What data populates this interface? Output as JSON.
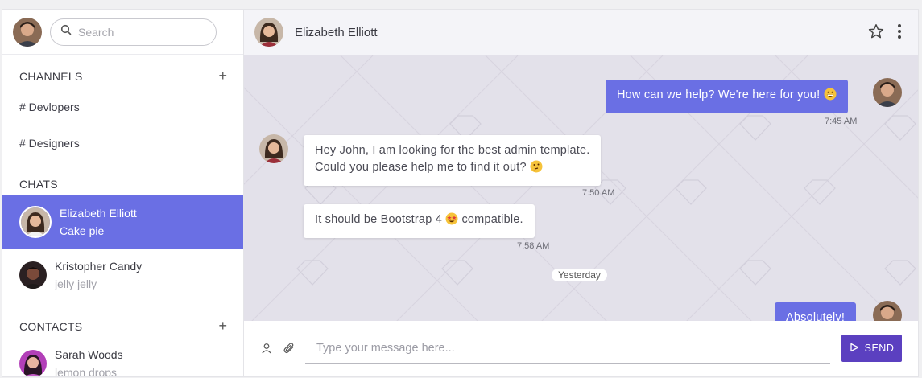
{
  "search": {
    "placeholder": "Search"
  },
  "sidebar": {
    "channels_heading": "CHANNELS",
    "channels": [
      {
        "label": "# Devlopers"
      },
      {
        "label": "# Designers"
      }
    ],
    "chats_heading": "CHATS",
    "chats": [
      {
        "name": "Elizabeth Elliott",
        "preview": "Cake pie",
        "active": true
      },
      {
        "name": "Kristopher Candy",
        "preview": "jelly jelly",
        "active": false
      }
    ],
    "contacts_heading": "CONTACTS",
    "contacts": [
      {
        "name": "Sarah Woods",
        "preview": "lemon drops"
      }
    ],
    "add_icon": "plus-icon"
  },
  "chat_header": {
    "name": "Elizabeth Elliott",
    "icons": [
      "star-icon",
      "more-vertical-icon"
    ]
  },
  "messages": [
    {
      "from": "me",
      "text": "How can we help? We're here for you!",
      "emoji": "grinning-face",
      "time": "7:45 AM"
    },
    {
      "from": "them",
      "text_line1": "Hey John, I am looking for the best admin template.",
      "text_line2": "Could you please help me to find it out?",
      "emoji": "thinking-face",
      "time": "7:50 AM"
    },
    {
      "from": "them",
      "text_before": "It should be Bootstrap 4",
      "emoji": "star-struck-face",
      "text_after": "compatible.",
      "time": "7:58 AM"
    },
    {
      "type": "date-separator",
      "text": "Yesterday"
    },
    {
      "from": "me",
      "text": "Absolutely!"
    }
  ],
  "composer": {
    "placeholder": "Type your message here...",
    "send_label": "SEND",
    "icons": [
      "person-icon",
      "paperclip-icon",
      "send-icon"
    ]
  },
  "colors": {
    "accent": "#6a6fe4",
    "send_button": "#5b40c0",
    "chat_bg": "#e3e1ea"
  }
}
